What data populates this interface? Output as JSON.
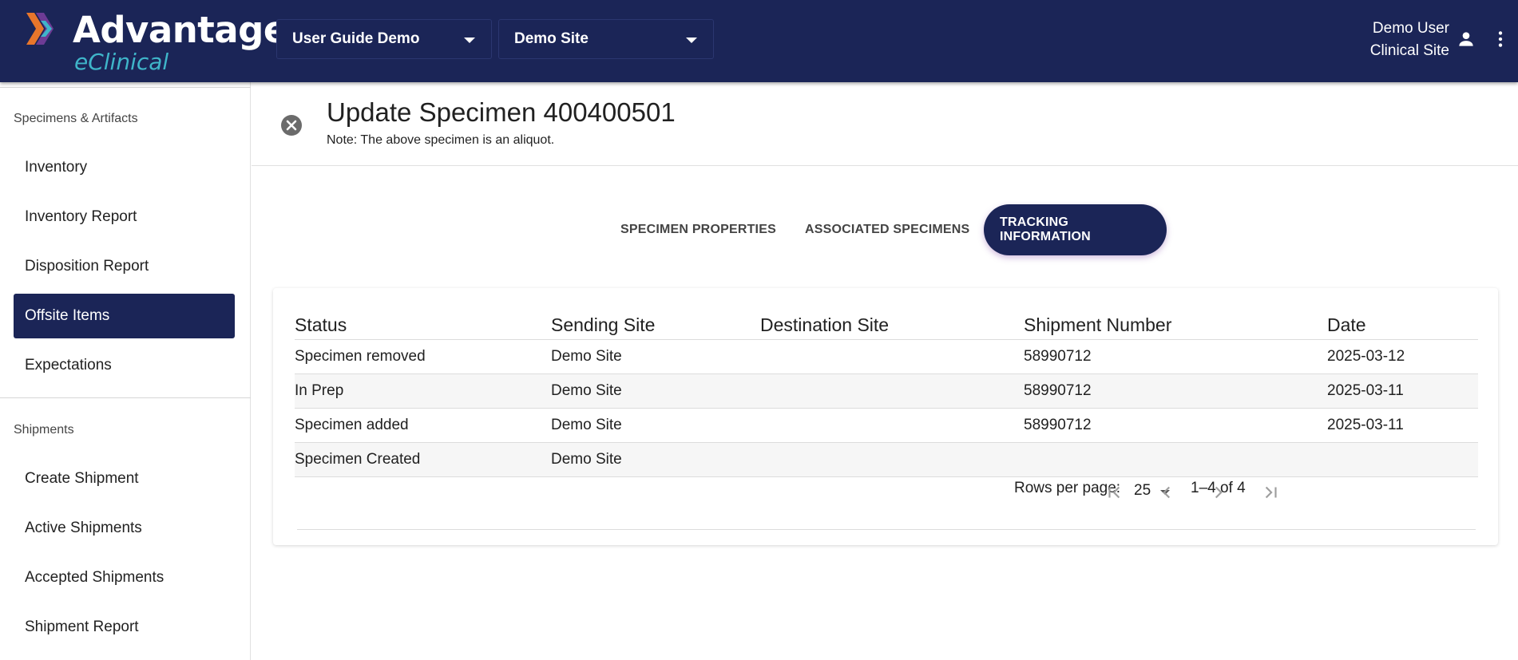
{
  "header": {
    "logo_title": "Advantage",
    "logo_subtitle": "eClinical",
    "study_select": "User Guide Demo",
    "site_select": "Demo Site",
    "user_name": "Demo User",
    "user_role": "Clinical Site",
    "colors": {
      "bar": "#1b2557",
      "accent": "#3fb5c9"
    }
  },
  "sidebar": {
    "section1": "Specimens & Artifacts",
    "items1": [
      "Inventory",
      "Inventory Report",
      "Disposition Report",
      "Offsite Items",
      "Expectations"
    ],
    "active_item": "Offsite Items",
    "section2": "Shipments",
    "items2": [
      "Create Shipment",
      "Active Shipments",
      "Accepted Shipments",
      "Shipment Report"
    ]
  },
  "page": {
    "title": "Update Specimen 400400501",
    "note": "Note: The above specimen is an aliquot."
  },
  "tabs": {
    "properties": "SPECIMEN PROPERTIES",
    "associated": "ASSOCIATED SPECIMENS",
    "tracking": "TRACKING INFORMATION"
  },
  "table": {
    "headers": [
      "Status",
      "Sending Site",
      "Destination Site",
      "Shipment Number",
      "Date"
    ],
    "rows": [
      [
        "Specimen removed",
        "Demo Site",
        "",
        "58990712",
        "2025-03-12"
      ],
      [
        "In Prep",
        "Demo Site",
        "",
        "58990712",
        "2025-03-11"
      ],
      [
        "Specimen added",
        "Demo Site",
        "",
        "58990712",
        "2025-03-11"
      ],
      [
        "Specimen Created",
        "Demo Site",
        "",
        "",
        ""
      ]
    ]
  },
  "pager": {
    "rows_label": "Rows per page:",
    "rows_value": "25",
    "range": "1–4 of 4"
  }
}
